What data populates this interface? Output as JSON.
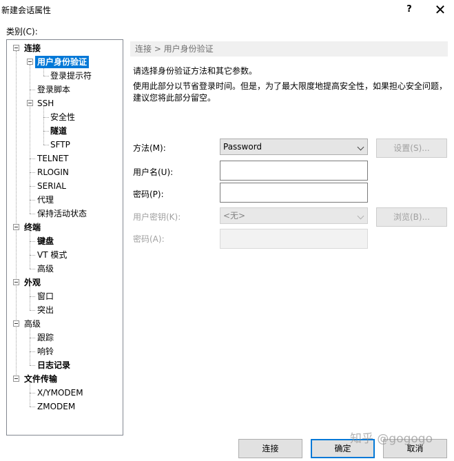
{
  "window": {
    "title": "新建会话属性",
    "help": "?",
    "close": "✕"
  },
  "category_label": "类别(C):",
  "tree": {
    "connection": "连接",
    "user_auth": "用户身份验证",
    "login_prompt": "登录提示符",
    "login_script": "登录脚本",
    "ssh": "SSH",
    "security": "安全性",
    "tunnel": "隧道",
    "sftp": "SFTP",
    "telnet": "TELNET",
    "rlogin": "RLOGIN",
    "serial": "SERIAL",
    "proxy": "代理",
    "keepalive": "保持活动状态",
    "terminal": "终端",
    "keyboard": "键盘",
    "vt_mode": "VT 模式",
    "term_advanced": "高级",
    "appearance": "外观",
    "window": "窗口",
    "highlight": "突出",
    "advanced": "高级",
    "trace": "跟踪",
    "bell": "响铃",
    "logging": "日志记录",
    "file_transfer": "文件传输",
    "xymodem": "X/YMODEM",
    "zmodem": "ZMODEM"
  },
  "panel": {
    "breadcrumb": "连接 > 用户身份验证",
    "desc1": "请选择身份验证方法和其它参数。",
    "desc2": "使用此部分以节省登录时间。但是，为了最大限度地提高安全性，如果担心安全问题，",
    "desc3": "建议您将此部分留空。",
    "method_label": "方法(M):",
    "method_value": "Password",
    "settings_btn": "设置(S)...",
    "username_label": "用户名(U):",
    "username_value": "",
    "password_label": "密码(P):",
    "password_value": "",
    "userkey_label": "用户密钥(K):",
    "userkey_value": "<无>",
    "browse_btn": "浏览(B)...",
    "passphrase_label": "密码(A):",
    "passphrase_value": ""
  },
  "buttons": {
    "connect": "连接",
    "ok": "确定",
    "cancel": "取消"
  },
  "watermark": "知乎 @gogogo"
}
